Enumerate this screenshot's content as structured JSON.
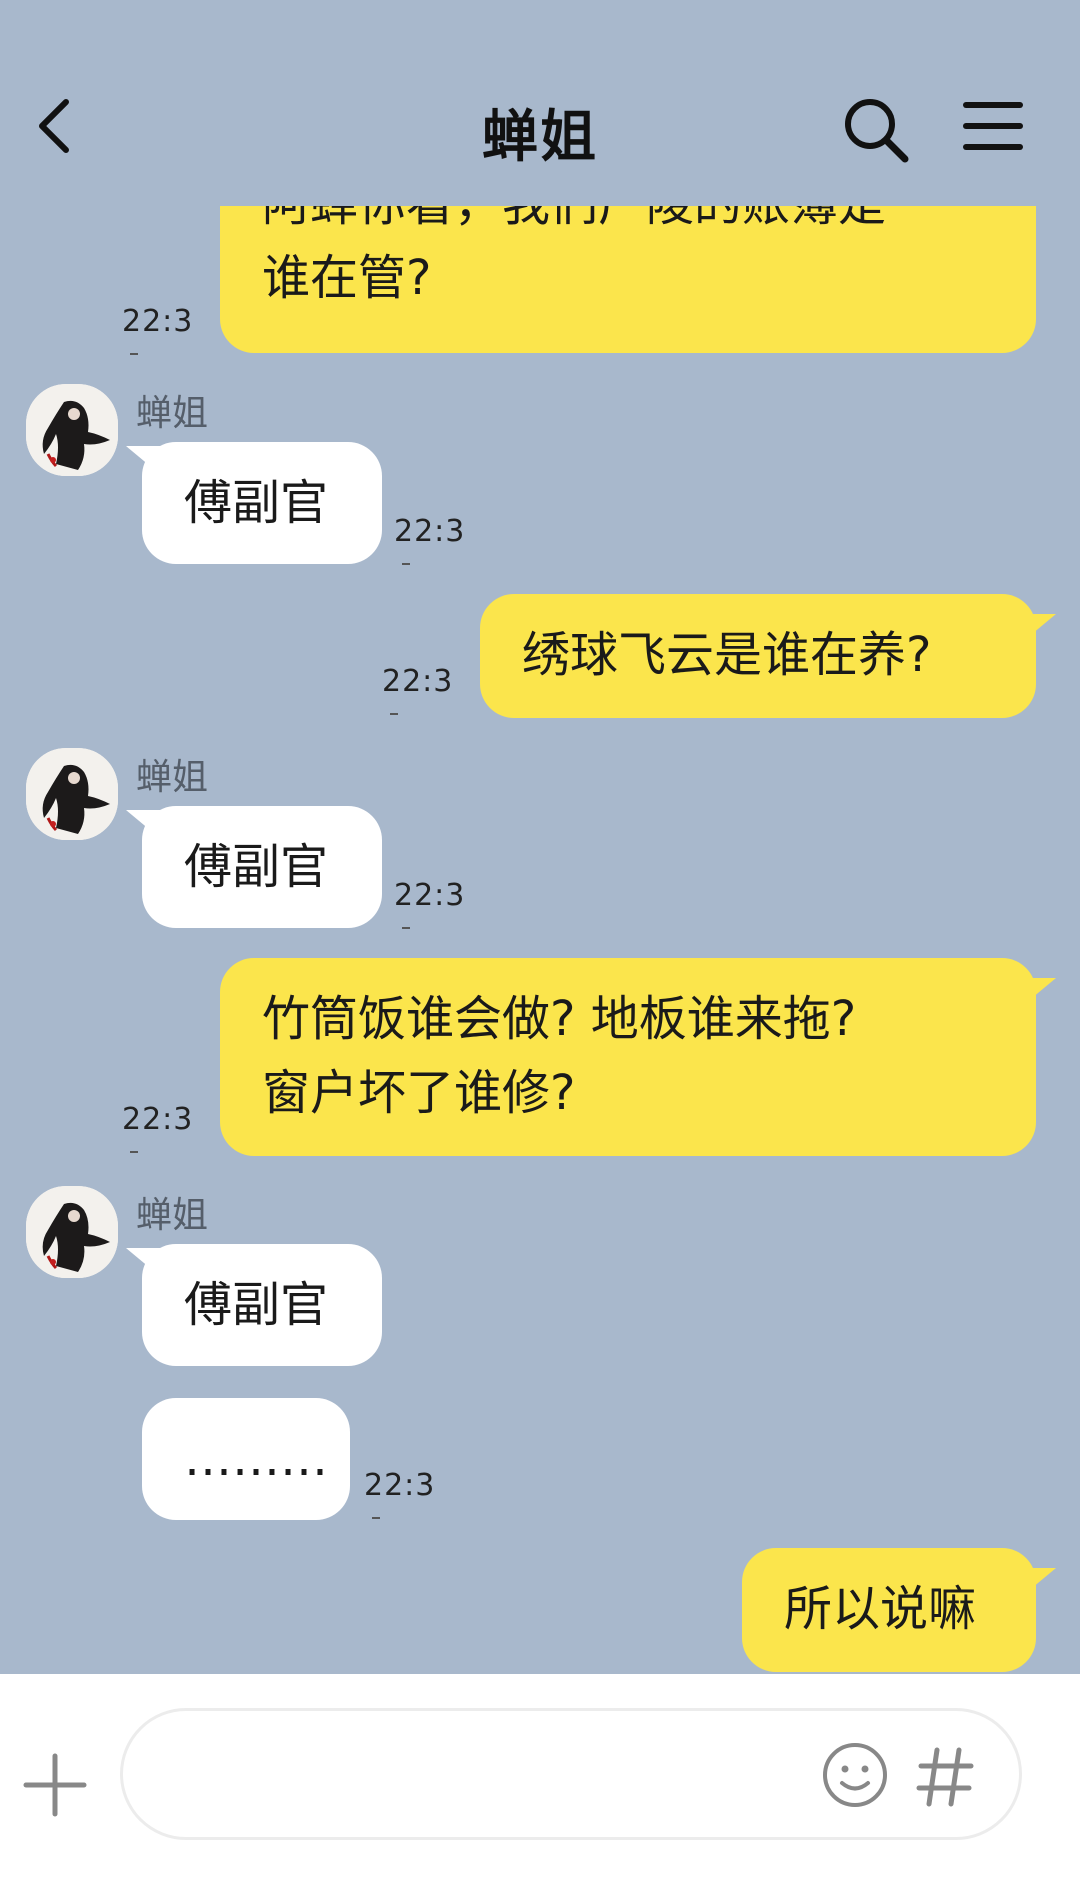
{
  "header": {
    "title": "蝉姐"
  },
  "messages": [
    {
      "side": "right",
      "line1": "阿蝉你看，我们广陵的账簿是",
      "line2": "谁在管?",
      "time": "22:3"
    },
    {
      "side": "left",
      "sender": "蝉姐",
      "text": "傅副官",
      "time": "22:3"
    },
    {
      "side": "right",
      "text": "绣球飞云是谁在养?",
      "time": "22:3"
    },
    {
      "side": "left",
      "sender": "蝉姐",
      "text": "傅副官",
      "time": "22:3"
    },
    {
      "side": "right",
      "line1": "竹筒饭谁会做? 地板谁来拖?",
      "line2": "窗户坏了谁修?",
      "time": "22:3"
    },
    {
      "side": "left",
      "sender": "蝉姐",
      "text": "傅副官"
    },
    {
      "side": "left",
      "text": "………",
      "time": "22:3"
    },
    {
      "side": "right",
      "text": "所以说嘛"
    }
  ],
  "input": {
    "value": "",
    "placeholder": ""
  },
  "colors": {
    "background": "#a8b8cc",
    "my_bubble": "#fbe54c",
    "their_bubble": "#ffffff"
  },
  "icons": [
    "back-arrow-icon",
    "search-icon",
    "menu-icon",
    "plus-icon",
    "emoji-icon",
    "hashtag-icon",
    "avatar"
  ]
}
